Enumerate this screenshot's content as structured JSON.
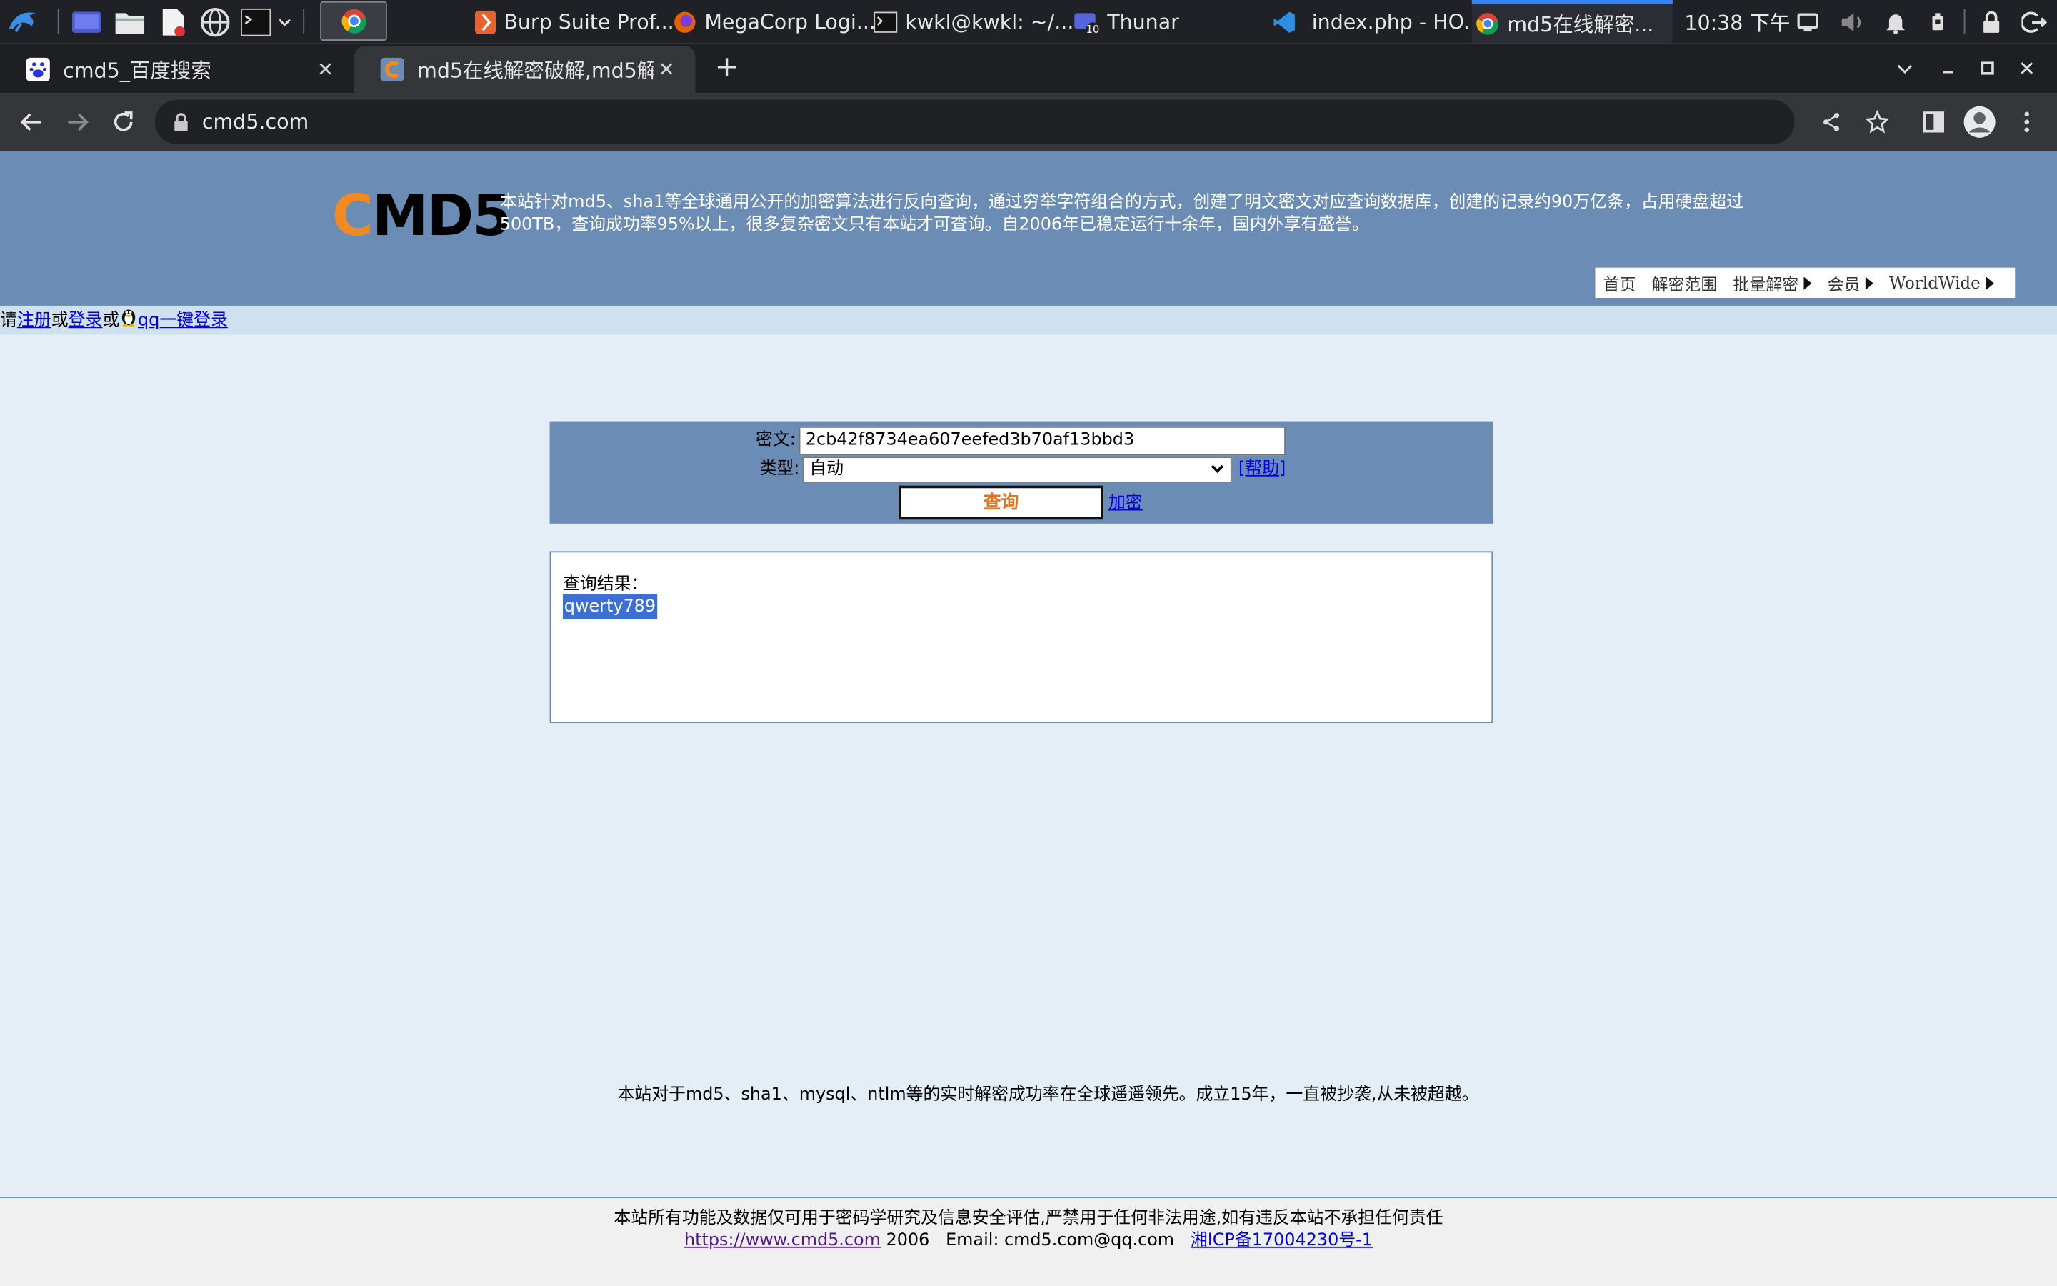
{
  "taskbar": {
    "windows": [
      {
        "label": "Burp Suite Prof...",
        "icon": "burp-icon"
      },
      {
        "label": "MegaCorp Logi...",
        "icon": "firefox-icon"
      },
      {
        "label": "kwkl@kwkl: ~/...",
        "icon": "terminal-icon"
      },
      {
        "label": "Thunar",
        "icon": "thunar-icon"
      },
      {
        "label": "index.php - HO...",
        "icon": "vscode-icon"
      },
      {
        "label": "md5在线解密...",
        "icon": "chrome-icon"
      }
    ],
    "clock": "10:38 下午"
  },
  "browser": {
    "tabs": [
      {
        "title": "cmd5_百度搜索",
        "icon": "baidu-icon"
      },
      {
        "title": "md5在线解密破解,md5解密",
        "icon": "cmd5-favicon"
      }
    ],
    "url": "cmd5.com"
  },
  "site": {
    "logo_c": "C",
    "logo_rest": "MD5",
    "intro": "本站针对md5、sha1等全球通用公开的加密算法进行反向查询，通过穷举字符组合的方式，创建了明文密文对应查询数据库，创建的记录约90万亿条，占用硬盘超过500TB，查询成功率95%以上，很多复杂密文只有本站才可查询。自2006年已稳定运行十余年，国内外享有盛誉。",
    "nav": [
      "首页",
      "解密范围",
      "批量解密",
      "会员",
      "WorldWide"
    ],
    "login": {
      "please": "请",
      "register": "注册",
      "or1": "或",
      "login": "登录",
      "or2": "或",
      "qq": "qq一键登录"
    },
    "form": {
      "cipher_label": "密文:",
      "cipher_value": "2cb42f8734ea607eefed3b70af13bbd3",
      "type_label": "类型:",
      "type_value": "自动",
      "help": "[帮助]",
      "query_button": "查询",
      "encrypt_link": "加密"
    },
    "result": {
      "label": "查询结果：",
      "value": "qwerty789"
    },
    "slogan": "本站对于md5、sha1、mysql、ntlm等的实时解密成功率在全球遥遥领先。成立15年，一直被抄袭,从未被超越。",
    "footer": {
      "disclaimer": "本站所有功能及数据仅可用于密码学研究及信息安全评估,严禁用于任何非法用途,如有违反本站不承担任何责任",
      "url": "https://www.cmd5.com",
      "year": "2006",
      "email": "Email: cmd5.com@qq.com",
      "icp": "湘ICP备17004230号-1"
    }
  },
  "colors": {
    "header_blue": "#6b8db5",
    "page_bg": "#e3eef6",
    "logo_orange": "#f28a24",
    "button_text": "#e8721c"
  }
}
